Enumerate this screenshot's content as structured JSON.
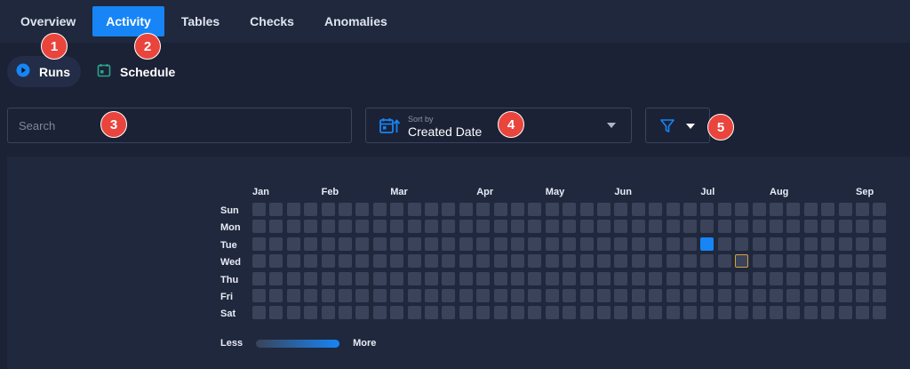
{
  "tabs": [
    {
      "label": "Overview",
      "name": "tab-overview",
      "active": false
    },
    {
      "label": "Activity",
      "name": "tab-activity",
      "active": true
    },
    {
      "label": "Tables",
      "name": "tab-tables",
      "active": false
    },
    {
      "label": "Checks",
      "name": "tab-checks",
      "active": false
    },
    {
      "label": "Anomalies",
      "name": "tab-anomalies",
      "active": false
    }
  ],
  "subnav": {
    "runs_label": "Runs",
    "runs_icon": "play-circle-icon",
    "schedule_label": "Schedule",
    "schedule_icon": "calendar-icon"
  },
  "search": {
    "placeholder": "Search"
  },
  "sort": {
    "caption": "Sort by",
    "value": "Created Date",
    "icon": "calendar-sort-icon"
  },
  "filter": {
    "icon": "funnel-icon"
  },
  "annotations": [
    "1",
    "2",
    "3",
    "4",
    "5"
  ],
  "heatmap": {
    "months": [
      "Jan",
      "Feb",
      "Mar",
      "Apr",
      "May",
      "Jun",
      "Jul",
      "Aug",
      "Sep"
    ],
    "month_week_index": [
      0,
      4,
      8,
      13,
      17,
      21,
      26,
      30,
      35
    ],
    "days": [
      "Sun",
      "Mon",
      "Tue",
      "Wed",
      "Thu",
      "Fri",
      "Sat"
    ],
    "weeks": 39,
    "active_cells": [
      {
        "week": 26,
        "day": 2
      }
    ],
    "highlighted_cells": [
      {
        "week": 28,
        "day": 3
      }
    ],
    "legend_less": "Less",
    "legend_more": "More"
  },
  "colors": {
    "accent": "#1785f5",
    "badge": "#e9453d",
    "empty_cell": "#3a4359",
    "highlight_border": "#d9a13d"
  }
}
